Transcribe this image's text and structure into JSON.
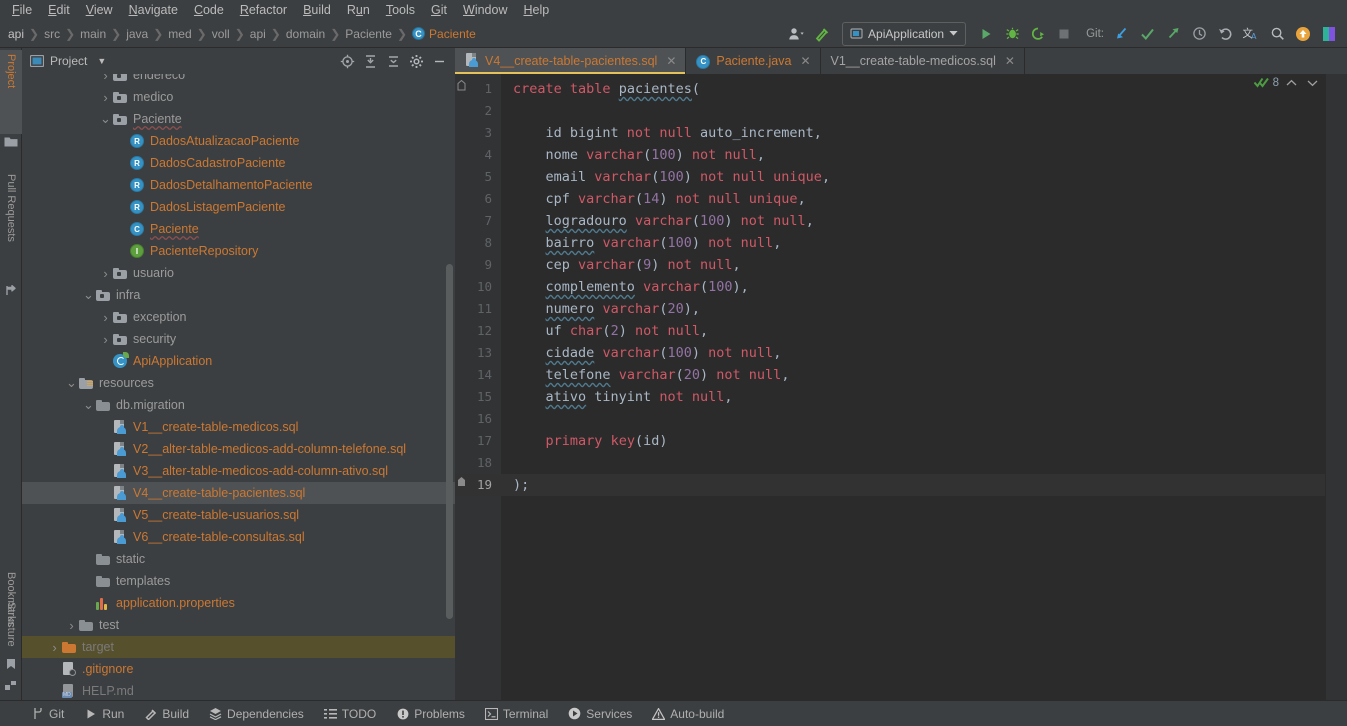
{
  "menubar": {
    "items": [
      {
        "label": "File",
        "mnemonic": "F"
      },
      {
        "label": "Edit",
        "mnemonic": "E"
      },
      {
        "label": "View",
        "mnemonic": "V"
      },
      {
        "label": "Navigate",
        "mnemonic": "N"
      },
      {
        "label": "Code",
        "mnemonic": "C"
      },
      {
        "label": "Refactor",
        "mnemonic": "R"
      },
      {
        "label": "Build",
        "mnemonic": "B"
      },
      {
        "label": "Run",
        "mnemonic": "u"
      },
      {
        "label": "Tools",
        "mnemonic": "T"
      },
      {
        "label": "Git",
        "mnemonic": "G"
      },
      {
        "label": "Window",
        "mnemonic": "W"
      },
      {
        "label": "Help",
        "mnemonic": "H"
      }
    ]
  },
  "navbar": {
    "breadcrumb": [
      "api",
      "src",
      "main",
      "java",
      "med",
      "voll",
      "api",
      "domain",
      "Paciente"
    ],
    "active_crumb": "Paciente",
    "active_crumb_icon": "C",
    "run_configuration": "ApiApplication",
    "git_label": "Git:",
    "icons": {
      "profile": "user-icon",
      "build": "hammer-icon",
      "run": "run-icon",
      "debug": "debug-icon",
      "run_coverage": "run-with-coverage-icon",
      "stop": "stop-icon",
      "update": "git-update-icon",
      "commit": "git-commit-icon",
      "push": "git-push-icon",
      "history": "history-icon",
      "rollback": "rollback-icon",
      "translate": "translate-icon",
      "search": "search-icon",
      "notifications": "notification-icon"
    }
  },
  "left_strip": {
    "tools": [
      {
        "label": "Project",
        "selected": true
      },
      {
        "label": "Pull Requests",
        "selected": false
      },
      {
        "label": "Bookmarks",
        "selected": false
      },
      {
        "label": "Structure",
        "selected": false
      }
    ]
  },
  "project_panel": {
    "title": "Project",
    "header_buttons": [
      "select-opened-file-icon",
      "expand-all-icon",
      "collapse-all-icon",
      "settings-gear-icon",
      "hide-icon"
    ],
    "tree": [
      {
        "depth": 4,
        "label": "endereco",
        "kind": "folder",
        "arrow": "collapsed",
        "clipped": true
      },
      {
        "depth": 4,
        "label": "medico",
        "kind": "folder",
        "arrow": "collapsed"
      },
      {
        "depth": 4,
        "label": "Paciente",
        "kind": "folder",
        "arrow": "expanded",
        "spell": true
      },
      {
        "depth": 5,
        "label": "DadosAtualizacaoPaciente",
        "kind": "record",
        "color": "orange"
      },
      {
        "depth": 5,
        "label": "DadosCadastroPaciente",
        "kind": "record",
        "color": "orange"
      },
      {
        "depth": 5,
        "label": "DadosDetalhamentoPaciente",
        "kind": "record",
        "color": "orange"
      },
      {
        "depth": 5,
        "label": "DadosListagemPaciente",
        "kind": "record",
        "color": "orange"
      },
      {
        "depth": 5,
        "label": "Paciente",
        "kind": "class",
        "color": "orange",
        "spell": true
      },
      {
        "depth": 5,
        "label": "PacienteRepository",
        "kind": "interface",
        "color": "orange"
      },
      {
        "depth": 4,
        "label": "usuario",
        "kind": "folder",
        "arrow": "collapsed"
      },
      {
        "depth": 3,
        "label": "infra",
        "kind": "folder",
        "arrow": "expanded"
      },
      {
        "depth": 4,
        "label": "exception",
        "kind": "folder",
        "arrow": "collapsed"
      },
      {
        "depth": 4,
        "label": "security",
        "kind": "folder",
        "arrow": "collapsed"
      },
      {
        "depth": 4,
        "label": "ApiApplication",
        "kind": "spring",
        "color": "orange"
      },
      {
        "depth": 2,
        "label": "resources",
        "kind": "resources-folder",
        "arrow": "expanded"
      },
      {
        "depth": 3,
        "label": "db.migration",
        "kind": "folder-plain",
        "arrow": "expanded"
      },
      {
        "depth": 4,
        "label": "V1__create-table-medicos.sql",
        "kind": "sql",
        "color": "orange"
      },
      {
        "depth": 4,
        "label": "V2__alter-table-medicos-add-column-telefone.sql",
        "kind": "sql",
        "color": "orange"
      },
      {
        "depth": 4,
        "label": "V3__alter-table-medicos-add-column-ativo.sql",
        "kind": "sql",
        "color": "orange"
      },
      {
        "depth": 4,
        "label": "V4__create-table-pacientes.sql",
        "kind": "sql",
        "color": "orange",
        "selected": true
      },
      {
        "depth": 4,
        "label": "V5__create-table-usuarios.sql",
        "kind": "sql",
        "color": "orange"
      },
      {
        "depth": 4,
        "label": "V6__create-table-consultas.sql",
        "kind": "sql",
        "color": "orange"
      },
      {
        "depth": 3,
        "label": "static",
        "kind": "folder-plain"
      },
      {
        "depth": 3,
        "label": "templates",
        "kind": "folder-plain"
      },
      {
        "depth": 3,
        "label": "application.properties",
        "kind": "properties",
        "color": "orange"
      },
      {
        "depth": 2,
        "label": "test",
        "kind": "folder-plain",
        "arrow": "collapsed"
      },
      {
        "depth": 1,
        "label": "target",
        "kind": "folder-orange",
        "arrow": "collapsed",
        "highlighted": true,
        "faded": true
      },
      {
        "depth": 1,
        "label": ".gitignore",
        "kind": "gitignore",
        "color": "orange"
      },
      {
        "depth": 1,
        "label": "HELP.md",
        "kind": "markdown",
        "faded": true,
        "clipped": true
      }
    ]
  },
  "editor": {
    "tabs": [
      {
        "label": "V4__create-table-pacientes.sql",
        "icon": "sql-file-icon",
        "active": true,
        "closable": true,
        "color": "orange"
      },
      {
        "label": "Paciente.java",
        "icon": "java-class-icon",
        "active": false,
        "closable": true,
        "color": "orange"
      },
      {
        "label": "V1__create-table-medicos.sql",
        "icon": "none",
        "active": false,
        "closable": true,
        "color": "grey"
      }
    ],
    "inspection": {
      "status_icon": "inspections-ok-icon",
      "count": "8",
      "up": "⌃",
      "down": "⌄"
    },
    "current_line": 19,
    "lines": [
      {
        "n": 1,
        "tokens": [
          {
            "t": "create",
            "c": "kw"
          },
          {
            "t": " ",
            "c": "p"
          },
          {
            "t": "table",
            "c": "kw"
          },
          {
            "t": " ",
            "c": "p"
          },
          {
            "t": "pacientes",
            "c": "sp"
          },
          {
            "t": "(",
            "c": "p"
          }
        ],
        "fold": "open"
      },
      {
        "n": 2,
        "tokens": []
      },
      {
        "n": 3,
        "tokens": [
          {
            "t": "    id bigint ",
            "c": "p"
          },
          {
            "t": "not",
            "c": "kw"
          },
          {
            "t": " ",
            "c": "p"
          },
          {
            "t": "null",
            "c": "kw"
          },
          {
            "t": " auto_increment,",
            "c": "p"
          }
        ]
      },
      {
        "n": 4,
        "tokens": [
          {
            "t": "    nome ",
            "c": "p"
          },
          {
            "t": "varchar",
            "c": "kw"
          },
          {
            "t": "(",
            "c": "p"
          },
          {
            "t": "100",
            "c": "num"
          },
          {
            "t": ") ",
            "c": "p"
          },
          {
            "t": "not",
            "c": "kw"
          },
          {
            "t": " ",
            "c": "p"
          },
          {
            "t": "null",
            "c": "kw"
          },
          {
            "t": ",",
            "c": "p"
          }
        ]
      },
      {
        "n": 5,
        "tokens": [
          {
            "t": "    email ",
            "c": "p"
          },
          {
            "t": "varchar",
            "c": "kw"
          },
          {
            "t": "(",
            "c": "p"
          },
          {
            "t": "100",
            "c": "num"
          },
          {
            "t": ") ",
            "c": "p"
          },
          {
            "t": "not",
            "c": "kw"
          },
          {
            "t": " ",
            "c": "p"
          },
          {
            "t": "null",
            "c": "kw"
          },
          {
            "t": " ",
            "c": "p"
          },
          {
            "t": "unique",
            "c": "kw"
          },
          {
            "t": ",",
            "c": "p"
          }
        ]
      },
      {
        "n": 6,
        "tokens": [
          {
            "t": "    cpf ",
            "c": "p"
          },
          {
            "t": "varchar",
            "c": "kw"
          },
          {
            "t": "(",
            "c": "p"
          },
          {
            "t": "14",
            "c": "num"
          },
          {
            "t": ") ",
            "c": "p"
          },
          {
            "t": "not",
            "c": "kw"
          },
          {
            "t": " ",
            "c": "p"
          },
          {
            "t": "null",
            "c": "kw"
          },
          {
            "t": " ",
            "c": "p"
          },
          {
            "t": "unique",
            "c": "kw"
          },
          {
            "t": ",",
            "c": "p"
          }
        ]
      },
      {
        "n": 7,
        "tokens": [
          {
            "t": "    ",
            "c": "p"
          },
          {
            "t": "logradouro",
            "c": "sp"
          },
          {
            "t": " ",
            "c": "p"
          },
          {
            "t": "varchar",
            "c": "kw"
          },
          {
            "t": "(",
            "c": "p"
          },
          {
            "t": "100",
            "c": "num"
          },
          {
            "t": ") ",
            "c": "p"
          },
          {
            "t": "not",
            "c": "kw"
          },
          {
            "t": " ",
            "c": "p"
          },
          {
            "t": "null",
            "c": "kw"
          },
          {
            "t": ",",
            "c": "p"
          }
        ]
      },
      {
        "n": 8,
        "tokens": [
          {
            "t": "    ",
            "c": "p"
          },
          {
            "t": "bairro",
            "c": "sp"
          },
          {
            "t": " ",
            "c": "p"
          },
          {
            "t": "varchar",
            "c": "kw"
          },
          {
            "t": "(",
            "c": "p"
          },
          {
            "t": "100",
            "c": "num"
          },
          {
            "t": ") ",
            "c": "p"
          },
          {
            "t": "not",
            "c": "kw"
          },
          {
            "t": " ",
            "c": "p"
          },
          {
            "t": "null",
            "c": "kw"
          },
          {
            "t": ",",
            "c": "p"
          }
        ]
      },
      {
        "n": 9,
        "tokens": [
          {
            "t": "    cep ",
            "c": "p"
          },
          {
            "t": "varchar",
            "c": "kw"
          },
          {
            "t": "(",
            "c": "p"
          },
          {
            "t": "9",
            "c": "num"
          },
          {
            "t": ") ",
            "c": "p"
          },
          {
            "t": "not",
            "c": "kw"
          },
          {
            "t": " ",
            "c": "p"
          },
          {
            "t": "null",
            "c": "kw"
          },
          {
            "t": ",",
            "c": "p"
          }
        ]
      },
      {
        "n": 10,
        "tokens": [
          {
            "t": "    ",
            "c": "p"
          },
          {
            "t": "complemento",
            "c": "sp"
          },
          {
            "t": " ",
            "c": "p"
          },
          {
            "t": "varchar",
            "c": "kw"
          },
          {
            "t": "(",
            "c": "p"
          },
          {
            "t": "100",
            "c": "num"
          },
          {
            "t": "),",
            "c": "p"
          }
        ]
      },
      {
        "n": 11,
        "tokens": [
          {
            "t": "    ",
            "c": "p"
          },
          {
            "t": "numero",
            "c": "sp"
          },
          {
            "t": " ",
            "c": "p"
          },
          {
            "t": "varchar",
            "c": "kw"
          },
          {
            "t": "(",
            "c": "p"
          },
          {
            "t": "20",
            "c": "num"
          },
          {
            "t": "),",
            "c": "p"
          }
        ]
      },
      {
        "n": 12,
        "tokens": [
          {
            "t": "    uf ",
            "c": "p"
          },
          {
            "t": "char",
            "c": "kw"
          },
          {
            "t": "(",
            "c": "p"
          },
          {
            "t": "2",
            "c": "num"
          },
          {
            "t": ") ",
            "c": "p"
          },
          {
            "t": "not",
            "c": "kw"
          },
          {
            "t": " ",
            "c": "p"
          },
          {
            "t": "null",
            "c": "kw"
          },
          {
            "t": ",",
            "c": "p"
          }
        ]
      },
      {
        "n": 13,
        "tokens": [
          {
            "t": "    ",
            "c": "p"
          },
          {
            "t": "cidade",
            "c": "sp"
          },
          {
            "t": " ",
            "c": "p"
          },
          {
            "t": "varchar",
            "c": "kw"
          },
          {
            "t": "(",
            "c": "p"
          },
          {
            "t": "100",
            "c": "num"
          },
          {
            "t": ") ",
            "c": "p"
          },
          {
            "t": "not",
            "c": "kw"
          },
          {
            "t": " ",
            "c": "p"
          },
          {
            "t": "null",
            "c": "kw"
          },
          {
            "t": ",",
            "c": "p"
          }
        ]
      },
      {
        "n": 14,
        "tokens": [
          {
            "t": "    ",
            "c": "p"
          },
          {
            "t": "telefone",
            "c": "sp"
          },
          {
            "t": " ",
            "c": "p"
          },
          {
            "t": "varchar",
            "c": "kw"
          },
          {
            "t": "(",
            "c": "p"
          },
          {
            "t": "20",
            "c": "num"
          },
          {
            "t": ") ",
            "c": "p"
          },
          {
            "t": "not",
            "c": "kw"
          },
          {
            "t": " ",
            "c": "p"
          },
          {
            "t": "null",
            "c": "kw"
          },
          {
            "t": ",",
            "c": "p"
          }
        ]
      },
      {
        "n": 15,
        "tokens": [
          {
            "t": "    ",
            "c": "p"
          },
          {
            "t": "ativo",
            "c": "sp"
          },
          {
            "t": " tinyint ",
            "c": "p"
          },
          {
            "t": "not",
            "c": "kw"
          },
          {
            "t": " ",
            "c": "p"
          },
          {
            "t": "null",
            "c": "kw"
          },
          {
            "t": ",",
            "c": "p"
          }
        ]
      },
      {
        "n": 16,
        "tokens": []
      },
      {
        "n": 17,
        "tokens": [
          {
            "t": "    ",
            "c": "p"
          },
          {
            "t": "primary",
            "c": "kw"
          },
          {
            "t": " ",
            "c": "p"
          },
          {
            "t": "key",
            "c": "kw"
          },
          {
            "t": "(id)",
            "c": "p"
          }
        ]
      },
      {
        "n": 18,
        "tokens": []
      },
      {
        "n": 19,
        "tokens": [
          {
            "t": ");",
            "c": "p"
          }
        ],
        "fold": "close"
      }
    ]
  },
  "statusbar": {
    "items": [
      {
        "label": "Git",
        "icon": "git-branch-icon"
      },
      {
        "label": "Run",
        "icon": "run-icon"
      },
      {
        "label": "Build",
        "icon": "hammer-icon"
      },
      {
        "label": "Dependencies",
        "icon": "layers-icon"
      },
      {
        "label": "TODO",
        "icon": "list-icon"
      },
      {
        "label": "Problems",
        "icon": "error-icon"
      },
      {
        "label": "Terminal",
        "icon": "terminal-icon"
      },
      {
        "label": "Services",
        "icon": "services-icon"
      },
      {
        "label": "Auto-build",
        "icon": "warning-icon"
      }
    ]
  },
  "colors": {
    "background": "#2b2b2b",
    "panel": "#3c3f41",
    "accent_orange": "#cc7832",
    "keyword": "#cf5967",
    "number": "#9373a5",
    "text": "#a9b7c6",
    "tab_underline": "#e5c15c",
    "selection": "#4e5254",
    "highlight_olive": "#57502d"
  }
}
